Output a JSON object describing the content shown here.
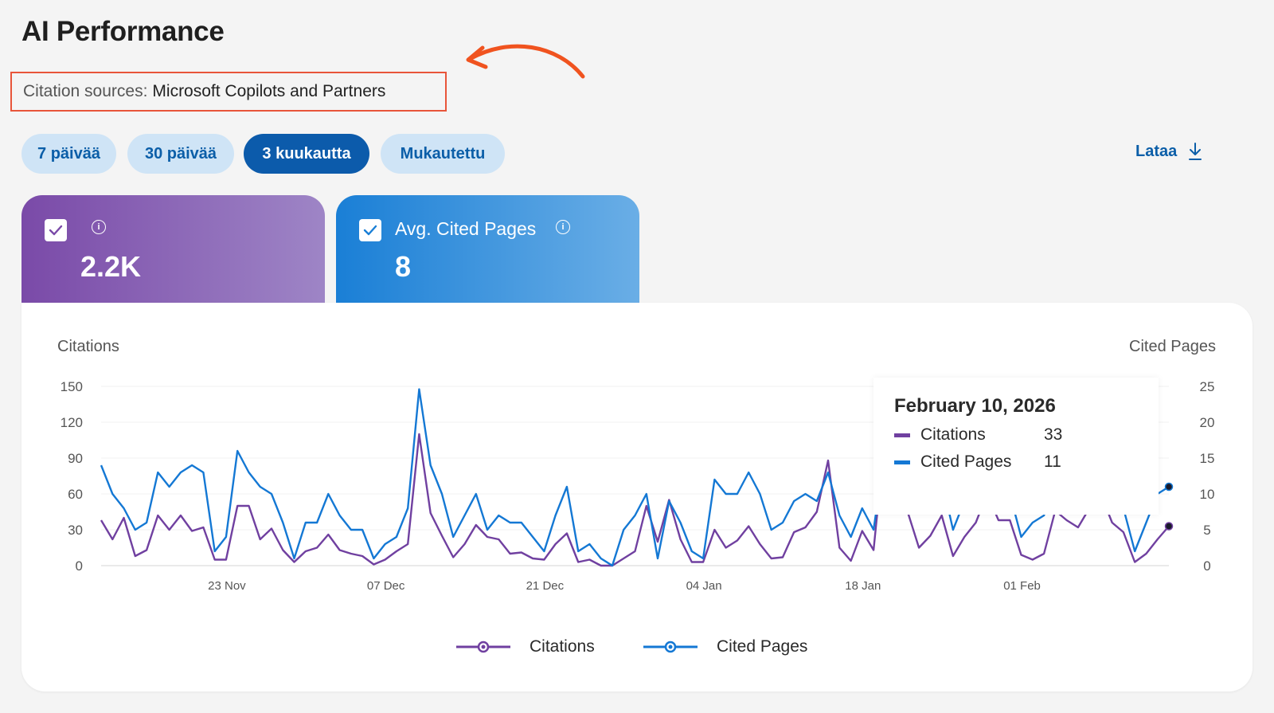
{
  "page": {
    "title": "AI Performance"
  },
  "source": {
    "label": "Citation sources:",
    "value": "Microsoft Copilots and Partners"
  },
  "ranges": [
    {
      "label": "7 päivää",
      "active": false
    },
    {
      "label": "30 päivää",
      "active": false
    },
    {
      "label": "3 kuukautta",
      "active": true
    },
    {
      "label": "Mukautettu",
      "active": false
    }
  ],
  "download": {
    "label": "Lataa",
    "icon": "download-icon"
  },
  "cards": [
    {
      "title": "",
      "value": "2.2K",
      "checked": true,
      "color": "#7a4aa8"
    },
    {
      "title": "Avg. Cited Pages",
      "value": "8",
      "checked": true,
      "color": "#1a7fd6"
    }
  ],
  "tooltip": {
    "date": "February 10, 2026",
    "rows": [
      {
        "name": "Citations",
        "value": "33",
        "color": "#7040a0"
      },
      {
        "name": "Cited Pages",
        "value": "11",
        "color": "#1478d4"
      }
    ]
  },
  "legend": [
    {
      "name": "Citations",
      "color": "#7040a0"
    },
    {
      "name": "Cited Pages",
      "color": "#1478d4"
    }
  ],
  "chart_data": {
    "type": "line",
    "ylabel": "Citations",
    "y2label": "Cited Pages",
    "ylim": [
      0,
      150
    ],
    "y2lim": [
      0,
      25
    ],
    "yticks": [
      0,
      30,
      60,
      90,
      120,
      150
    ],
    "y2ticks": [
      0,
      5,
      10,
      15,
      20,
      25
    ],
    "xticks": [
      "23 Nov",
      "07 Dec",
      "21 Dec",
      "04 Jan",
      "18 Jan",
      "01 Feb"
    ],
    "grid": true,
    "legend_position": "bottom",
    "series": [
      {
        "name": "Citations",
        "axis": "left",
        "color": "#7040a0",
        "values": [
          38,
          22,
          40,
          8,
          13,
          42,
          30,
          42,
          29,
          32,
          5,
          5,
          50,
          50,
          22,
          31,
          13,
          3,
          12,
          15,
          26,
          13,
          10,
          8,
          1,
          5,
          12,
          18,
          110,
          44,
          25,
          7,
          18,
          34,
          24,
          22,
          10,
          11,
          6,
          5,
          18,
          27,
          3,
          5,
          0,
          0,
          6,
          12,
          50,
          20,
          55,
          22,
          3,
          3,
          30,
          15,
          21,
          33,
          18,
          6,
          7,
          28,
          32,
          45,
          88,
          15,
          4,
          29,
          13,
          108,
          70,
          45,
          15,
          25,
          42,
          8,
          24,
          36,
          60,
          38,
          38,
          9,
          5,
          10,
          46,
          38,
          32,
          48,
          60,
          36,
          28,
          3,
          10,
          22,
          33
        ]
      },
      {
        "name": "Cited Pages",
        "axis": "right",
        "color": "#1478d4",
        "values": [
          14,
          10,
          8,
          5,
          6,
          13,
          11,
          13,
          14,
          13,
          2,
          4,
          16,
          13,
          11,
          10,
          6,
          1,
          6,
          6,
          10,
          7,
          5,
          5,
          1,
          3,
          4,
          8,
          24.6,
          14,
          10,
          4,
          7,
          10,
          5,
          7,
          6,
          6,
          4,
          2,
          7,
          11,
          2,
          3,
          1,
          0,
          5,
          7,
          10,
          1,
          9,
          6,
          2,
          1,
          12,
          10,
          10,
          13,
          10,
          5,
          6,
          9,
          10,
          9,
          13,
          7,
          4,
          8,
          5,
          16,
          14,
          11,
          8,
          9,
          12,
          5,
          9,
          10,
          12,
          9,
          10,
          4,
          6,
          7,
          12,
          10,
          8,
          11,
          13,
          10,
          8,
          2,
          6,
          10,
          11
        ]
      }
    ]
  }
}
